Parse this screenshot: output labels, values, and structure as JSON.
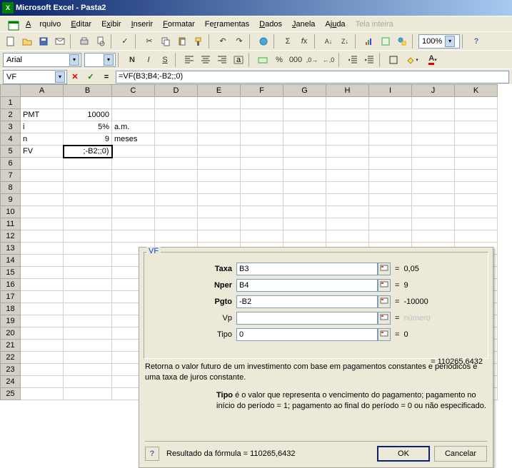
{
  "title": "Microsoft Excel - Pasta2",
  "menu": {
    "arquivo": "Arquivo",
    "editar": "Editar",
    "exibir": "Exibir",
    "inserir": "Inserir",
    "formatar": "Formatar",
    "ferramentas": "Ferramentas",
    "dados": "Dados",
    "janela": "Janela",
    "ajuda": "Ajuda",
    "tela": "Tela inteira"
  },
  "fontcombo": "Arial",
  "sizecombo": "",
  "zoom": "100%",
  "namebox": "VF",
  "formula": "=VF(B3;B4;-B2;;0)",
  "cols": [
    "A",
    "B",
    "C",
    "D",
    "E",
    "F",
    "G",
    "H",
    "I",
    "J",
    "K"
  ],
  "cells": {
    "A2": "PMT",
    "B2": "10000",
    "A3": "i",
    "B3": "5%",
    "C3": "a.m.",
    "A4": "n",
    "B4": "9",
    "C4": "meses",
    "A5": "FV",
    "B5": ";-B2;;0)"
  },
  "dialog": {
    "fn": "VF",
    "rows": [
      {
        "label": "Taxa",
        "value": "B3",
        "result": "0,05",
        "bold": true
      },
      {
        "label": "Nper",
        "value": "B4",
        "result": "9",
        "bold": true
      },
      {
        "label": "Pgto",
        "value": "-B2",
        "result": "-10000",
        "bold": true
      },
      {
        "label": "Vp",
        "value": "",
        "result": "número",
        "bold": false,
        "gray": true
      },
      {
        "label": "Tipo",
        "value": "0",
        "result": "0",
        "bold": false
      }
    ],
    "calc": "= 110265,6432",
    "desc": "Retorna o valor futuro de um investimento com base em pagamentos constantes e periódicos e uma taxa de juros constante.",
    "paramname": "Tipo",
    "paramdesc": "é o valor que representa o vencimento do pagamento; pagamento no início do período = 1; pagamento ao final do período = 0 ou não especificado.",
    "resultlabel": "Resultado da fórmula =",
    "resultval": "110265,6432",
    "ok": "OK",
    "cancel": "Cancelar"
  }
}
